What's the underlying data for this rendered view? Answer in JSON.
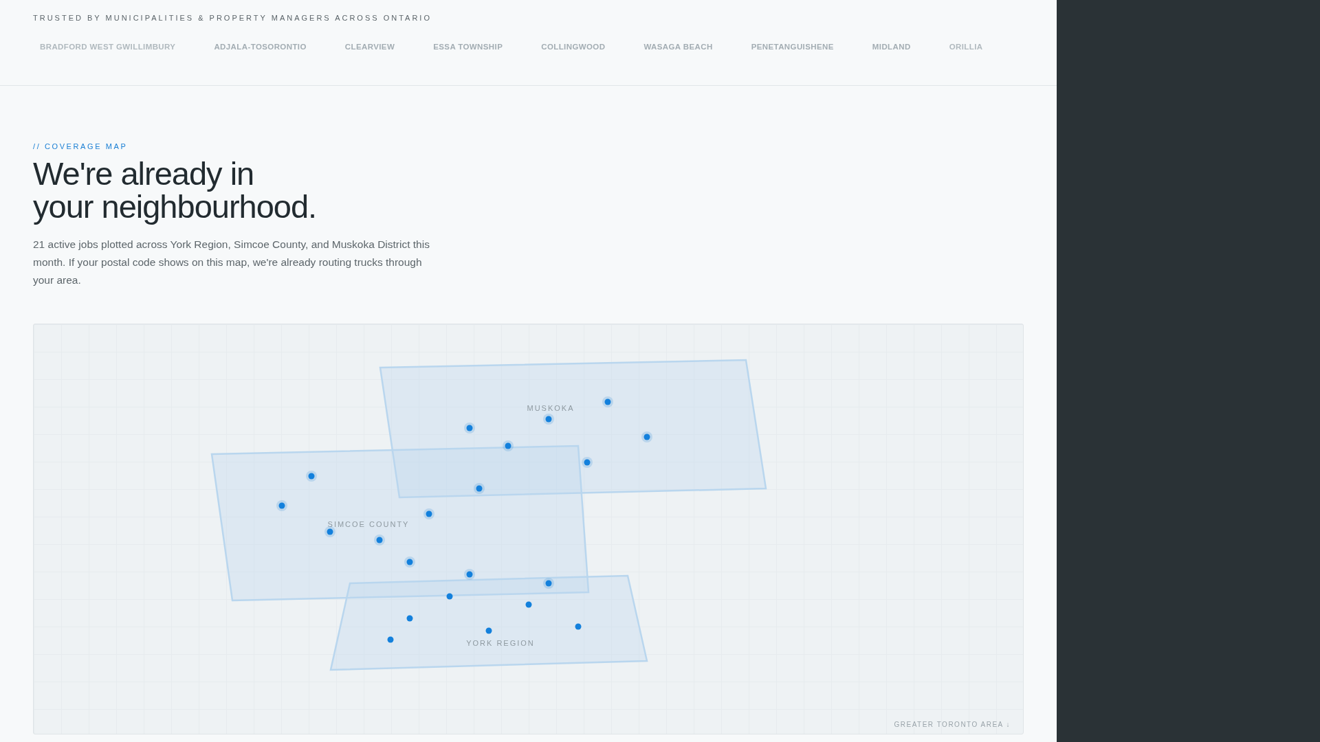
{
  "trust_bar": {
    "title": "TRUSTED BY MUNICIPALITIES & PROPERTY MANAGERS ACROSS ONTARIO",
    "municipalities": [
      "BRADFORD WEST GWILLIMBURY",
      "ADJALA-TOSORONTIO",
      "CLEARVIEW",
      "ESSA TOWNSHIP",
      "COLLINGWOOD",
      "WASAGA BEACH",
      "PENETANGUISHENE",
      "MIDLAND",
      "ORILLIA"
    ]
  },
  "coverage": {
    "eyebrow": "// COVERAGE MAP",
    "heading": [
      "We're already in",
      "your neighbourhood."
    ],
    "description": "21 active jobs plotted across York Region, Simcoe County, and Muskoka District this month. If your postal code shows on this map, we're already routing trucks through your area."
  },
  "map": {
    "regions": [
      {
        "kind": "muskoka",
        "label": "MUSKOKA"
      },
      {
        "kind": "simcoe",
        "label": "SIMCOE COUNTY"
      },
      {
        "kind": "york",
        "label": "YORK REGION"
      }
    ],
    "corner_label": "GREATER TORONTO AREA ↓"
  }
}
